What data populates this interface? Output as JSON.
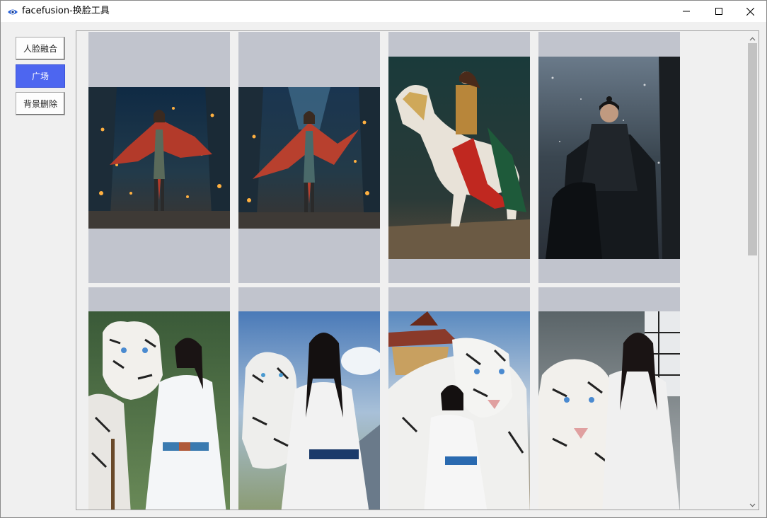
{
  "window": {
    "title": "facefusion-换脸工具",
    "app_icon": "eye-logo-icon",
    "controls": [
      "minimize-icon",
      "maximize-icon",
      "close-icon"
    ]
  },
  "sidebar": {
    "items": [
      {
        "label": "人脸融合",
        "active": false
      },
      {
        "label": "广场",
        "active": true
      },
      {
        "label": "背景删除",
        "active": false
      }
    ]
  },
  "gallery": {
    "items": [
      {
        "subject": "warrior woman red cape lantern cavern",
        "icon": "image-thumbnail"
      },
      {
        "subject": "warrior woman red cape lantern cavern variant",
        "icon": "image-thumbnail"
      },
      {
        "subject": "armored woman on white horse",
        "icon": "image-thumbnail"
      },
      {
        "subject": "black armored warrior in snow forest",
        "icon": "image-thumbnail"
      },
      {
        "subject": "woman in white with white tiger",
        "icon": "image-thumbnail"
      },
      {
        "subject": "woman in white with white tiger mountains",
        "icon": "image-thumbnail"
      },
      {
        "subject": "girl with giant white tiger pagoda",
        "icon": "image-thumbnail"
      },
      {
        "subject": "woman seated with white tiger",
        "icon": "image-thumbnail"
      }
    ]
  },
  "colors": {
    "accent": "#4d66f0",
    "card_bg": "#c1c4cd",
    "window_bg": "#f0f0f0"
  }
}
